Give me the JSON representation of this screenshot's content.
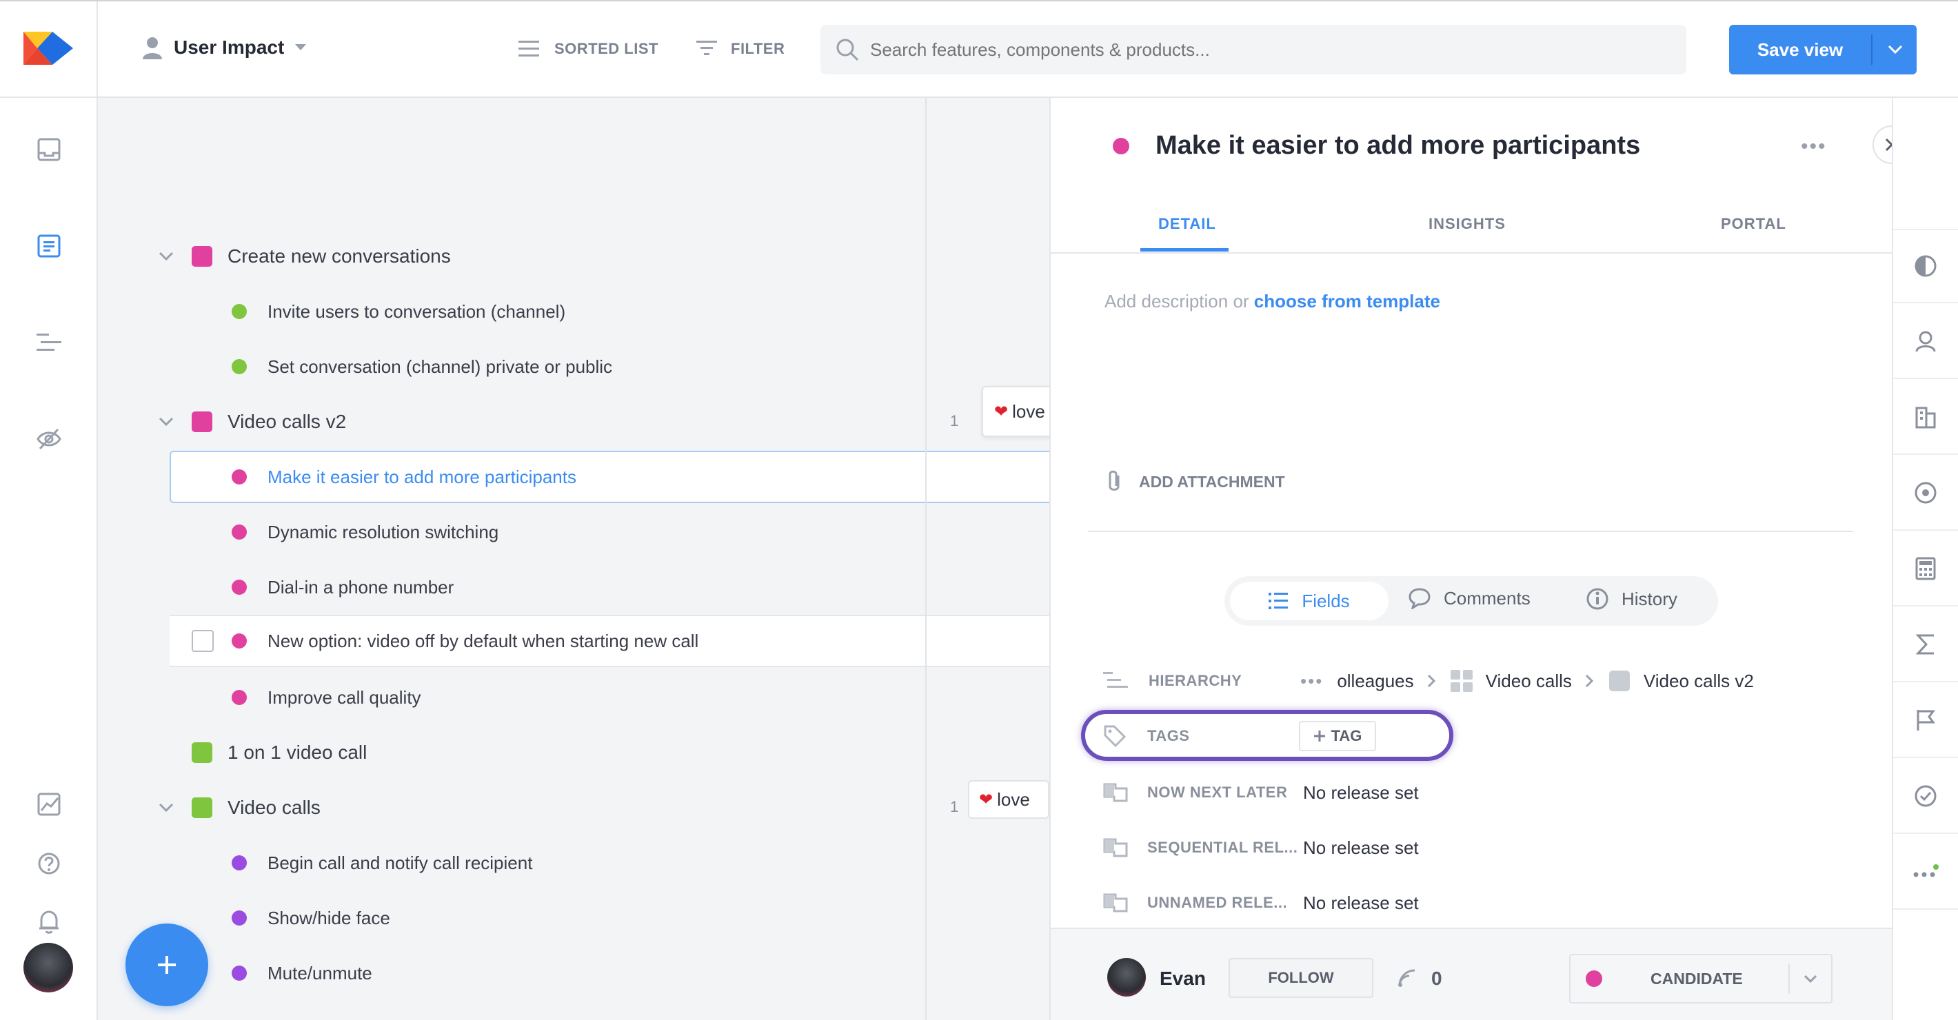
{
  "header": {
    "view_name": "User Impact",
    "sorted_list": "SORTED LIST",
    "filter": "FILTER",
    "search_placeholder": "Search features, components & products...",
    "save_view": "Save view"
  },
  "tree": {
    "items": [
      {
        "label": "Create new conversations",
        "kind": "group",
        "color": "#e0419f"
      },
      {
        "label": "Invite users to conversation (channel)",
        "kind": "child",
        "color": "#7fc63e"
      },
      {
        "label": "Set conversation (channel) private or public",
        "kind": "child",
        "color": "#7fc63e"
      },
      {
        "label": "Video calls v2",
        "kind": "group",
        "color": "#e0419f",
        "count": "1",
        "tag": "love"
      },
      {
        "label": "Make it easier to add more participants",
        "kind": "child",
        "color": "#e0419f",
        "selected": true
      },
      {
        "label": "Dynamic resolution switching",
        "kind": "child",
        "color": "#e0419f"
      },
      {
        "label": "Dial-in a phone number",
        "kind": "child",
        "color": "#e0419f"
      },
      {
        "label": "New option: video off by default when starting new call",
        "kind": "child",
        "color": "#e0419f"
      },
      {
        "label": "Improve call quality",
        "kind": "child",
        "color": "#e0419f"
      },
      {
        "label": "1 on 1 video call",
        "kind": "group",
        "color": "#7fc63e"
      },
      {
        "label": "Video calls",
        "kind": "group",
        "color": "#7fc63e",
        "count": "1",
        "tag": "love"
      },
      {
        "label": "Begin call and notify call recipient",
        "kind": "child",
        "color": "#9a4be0"
      },
      {
        "label": "Show/hide face",
        "kind": "child",
        "color": "#9a4be0"
      },
      {
        "label": "Mute/unmute",
        "kind": "child",
        "color": "#9a4be0"
      }
    ]
  },
  "detail": {
    "title": "Make it easier to add more participants",
    "status_color": "#e0419f",
    "tabs": [
      "DETAIL",
      "INSIGHTS",
      "PORTAL"
    ],
    "description_prefix": "Add description or ",
    "description_link": "choose from template",
    "add_attachment": "ADD ATTACHMENT",
    "subtabs": [
      "Fields",
      "Comments",
      "History"
    ],
    "fields": {
      "hierarchy_label": "HIERARCHY",
      "hierarchy_path": [
        "olleagues",
        "Video calls",
        "Video calls v2"
      ],
      "tags_label": "TAGS",
      "tag_button": "TAG",
      "now_next_later_label": "NOW NEXT LATER",
      "now_next_later_value": "No release set",
      "sequential_label": "SEQUENTIAL REL...",
      "sequential_value": "No release set",
      "unnamed_label": "UNNAMED RELE...",
      "unnamed_value": "No release set"
    },
    "footer": {
      "user": "Evan",
      "follow": "FOLLOW",
      "followers": "0",
      "status": "CANDIDATE"
    }
  },
  "colors": {
    "accent": "#3b8cf0",
    "highlight_ring": "#6b4fbb"
  }
}
